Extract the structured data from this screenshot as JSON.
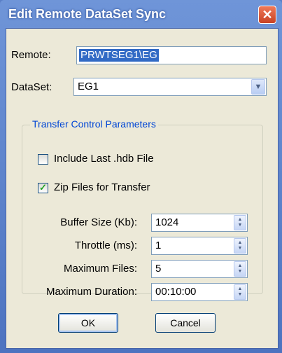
{
  "window": {
    "title": "Edit Remote DataSet Sync",
    "close_glyph": "✕"
  },
  "remote": {
    "label": "Remote:",
    "value": "PRWTSEG1\\EG"
  },
  "dataset": {
    "label": "DataSet:",
    "value": "EG1"
  },
  "group": {
    "title": "Transfer Control Parameters",
    "include_last_hdb": {
      "label": "Include Last .hdb File",
      "checked": false
    },
    "zip_files": {
      "label": "Zip Files for Transfer",
      "checked": true
    },
    "fields": [
      {
        "label": "Buffer Size (Kb):",
        "value": "1024"
      },
      {
        "label": "Throttle  (ms):",
        "value": "1"
      },
      {
        "label": "Maximum Files:",
        "value": "5"
      },
      {
        "label": "Maximum Duration:",
        "value": "00:10:00"
      }
    ]
  },
  "buttons": {
    "ok": "OK",
    "cancel": "Cancel"
  },
  "icons": {
    "dropdown": "chevron-down-icon",
    "spin_up": "▲",
    "spin_down": "▼",
    "check": "✓"
  },
  "colors": {
    "title_bar": "#5a7fc7",
    "client_bg": "#ece9d8",
    "group_title": "#0046d5",
    "selection": "#316ac5",
    "close": "#d65232"
  }
}
